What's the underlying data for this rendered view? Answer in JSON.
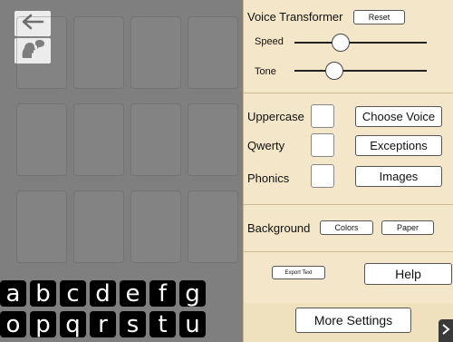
{
  "left": {
    "back_icon": "arrow-left",
    "speaker_icon": "speaking-head",
    "letters_row1": [
      "a",
      "b",
      "c",
      "d",
      "e",
      "f",
      "g"
    ],
    "letters_row2": [
      "o",
      "p",
      "q",
      "r",
      "s",
      "t",
      "u"
    ]
  },
  "voice_transformer": {
    "title": "Voice Transformer",
    "reset_label": "Reset",
    "speed_label": "Speed",
    "speed_value": 0.35,
    "tone_label": "Tone",
    "tone_value": 0.3
  },
  "options": {
    "uppercase_label": "Uppercase",
    "qwerty_label": "Qwerty",
    "phonics_label": "Phonics",
    "choose_voice_label": "Choose Voice",
    "exceptions_label": "Exceptions",
    "images_label": "Images"
  },
  "background": {
    "label": "Background",
    "colors_label": "Colors",
    "paper_label": "Paper"
  },
  "footer": {
    "export_label": "Export Text",
    "help_label": "Help",
    "more_settings_label": "More Settings",
    "corner_icon": "chevron-right"
  },
  "colors": {
    "panel_bg": "#f3e6c9",
    "workspace_bg": "#7f7f7f",
    "tile_bg": "#000000"
  }
}
